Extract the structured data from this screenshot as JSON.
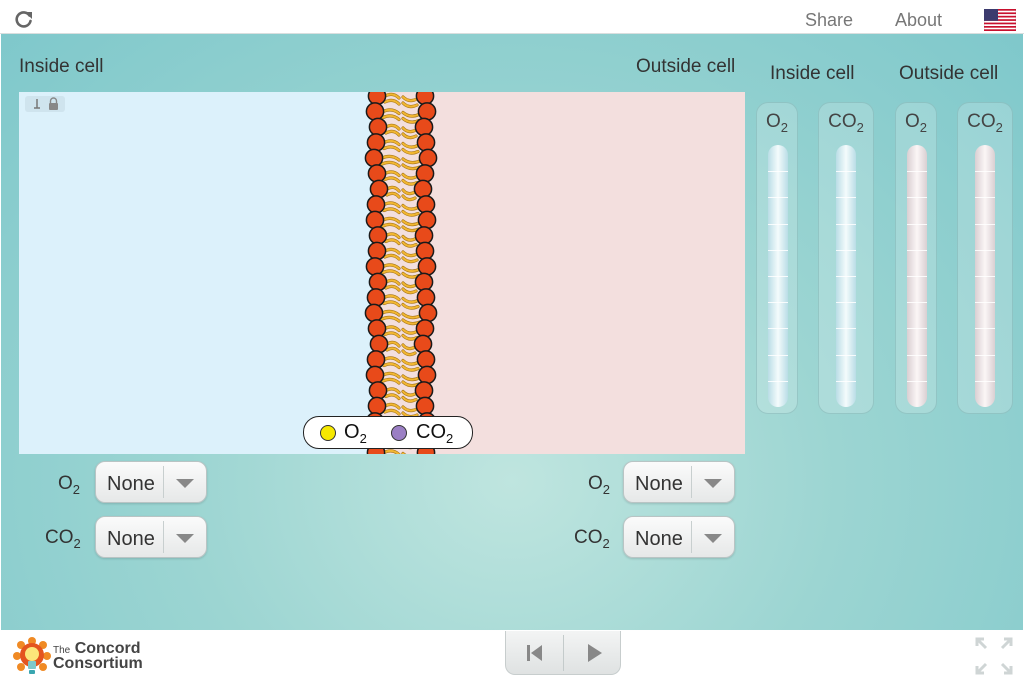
{
  "topbar": {
    "share_label": "Share",
    "about_label": "About",
    "reload_icon": "reload-icon",
    "flag_icon": "us-flag-icon"
  },
  "sim": {
    "inside_label": "Inside cell",
    "outside_label": "Outside cell",
    "inside_color": "#dcf1fb",
    "outside_color": "#f3dfde",
    "head_color": "#e84a1a",
    "tail_color": "#f2b731",
    "legend": {
      "o2_base": "O",
      "o2_sub": "2",
      "co2_base": "CO",
      "co2_sub": "2",
      "o2_color": "#f6e800",
      "co2_color": "#9b7fc4"
    }
  },
  "controls": {
    "inside": {
      "o2_label_base": "O",
      "o2_label_sub": "2",
      "o2_value": "None",
      "co2_label_base": "CO",
      "co2_label_sub": "2",
      "co2_value": "None"
    },
    "outside": {
      "o2_label_base": "O",
      "o2_label_sub": "2",
      "o2_value": "None",
      "co2_label_base": "CO",
      "co2_label_sub": "2",
      "co2_value": "None"
    }
  },
  "meters": {
    "inside_label": "Inside cell",
    "outside_label": "Outside cell",
    "inside": [
      {
        "base": "O",
        "sub": "2",
        "level": 0
      },
      {
        "base": "CO",
        "sub": "2",
        "level": 0
      }
    ],
    "outside": [
      {
        "base": "O",
        "sub": "2",
        "level": 0
      },
      {
        "base": "CO",
        "sub": "2",
        "level": 0
      }
    ]
  },
  "footer": {
    "logo_line1_small": "The",
    "logo_line1": "Concord",
    "logo_line2": "Consortium",
    "logo_icon": "lightbulb-logo-icon",
    "reset_icon": "reset-icon",
    "play_icon": "play-icon",
    "fullscreen_icon": "fullscreen-icon"
  }
}
